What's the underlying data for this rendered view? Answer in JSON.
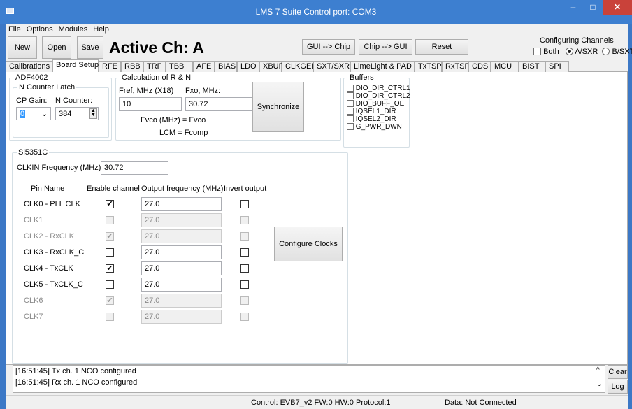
{
  "window": {
    "title": "LMS 7 Suite  Control port: COM3",
    "min": "–",
    "max": "□",
    "close": "✕"
  },
  "menu": [
    "File",
    "Options",
    "Modules",
    "Help"
  ],
  "toolbar": {
    "new": "New",
    "open": "Open",
    "save": "Save",
    "active_channel": "Active Ch: A",
    "gui_to_chip": "GUI --> Chip",
    "chip_to_gui": "Chip --> GUI",
    "reset": "Reset"
  },
  "configuring": {
    "title": "Configuring Channels",
    "both": "Both",
    "a": "A/SXR",
    "b": "B/SXT",
    "selected": "A/SXR"
  },
  "tabs": [
    "Calibrations",
    "Board Setup",
    "RFE",
    "RBB",
    "TRF",
    "TBB",
    "AFE",
    "BIAS",
    "LDO",
    "XBUF",
    "CLKGEN",
    "SXT/SXR",
    "LimeLight & PAD",
    "TxTSP",
    "RxTSP",
    "CDS",
    "MCU",
    "BIST",
    "SPI"
  ],
  "active_tab": "Board Setup",
  "adf": {
    "title": "ADF4002",
    "ncl_title": "N Counter Latch",
    "cp_gain_label": "CP Gain:",
    "cp_gain_value": "0",
    "n_counter_label": "N Counter:",
    "n_counter_value": "384"
  },
  "calc": {
    "title": "Calculation of R & N",
    "fref_label": "Fref, MHz (X18)",
    "fref_value": "10",
    "fxo_label": "Fxo, MHz:",
    "fxo_value": "30.72",
    "fvco": "Fvco (MHz) = Fvco",
    "lcm": "LCM = Fcomp",
    "sync": "Synchronize"
  },
  "buffers": {
    "title": "Buffers",
    "items": [
      "DIO_DIR_CTRL1",
      "DIO_DIR_CTRL2",
      "DIO_BUFF_OE",
      "IQSEL1_DIR",
      "IQSEL2_DIR",
      "G_PWR_DWN"
    ]
  },
  "si": {
    "title": "Si5351C",
    "clkin_label": "CLKIN Frequency (MHz):",
    "clkin_value": "30.72",
    "headers": {
      "pin": "Pin Name",
      "enable": "Enable channel",
      "freq": "Output frequency (MHz)",
      "invert": "Invert output"
    },
    "rows": [
      {
        "name": "CLK0 - PLL CLK",
        "enabled": true,
        "freq": "27.0",
        "active": true
      },
      {
        "name": "CLK1",
        "enabled": false,
        "freq": "27.0",
        "active": false
      },
      {
        "name": "CLK2 - RxCLK",
        "enabled": true,
        "freq": "27.0",
        "active": false
      },
      {
        "name": "CLK3 - RxCLK_C",
        "enabled": false,
        "freq": "27.0",
        "active": true
      },
      {
        "name": "CLK4 - TxCLK",
        "enabled": true,
        "freq": "27.0",
        "active": true
      },
      {
        "name": "CLK5 - TxCLK_C",
        "enabled": false,
        "freq": "27.0",
        "active": true
      },
      {
        "name": "CLK6",
        "enabled": true,
        "freq": "27.0",
        "active": false
      },
      {
        "name": "CLK7",
        "enabled": false,
        "freq": "27.0",
        "active": false
      }
    ],
    "configure": "Configure Clocks"
  },
  "log": [
    "[16:51:45] Tx ch. 1 NCO configured",
    "[16:51:45] Rx ch. 1 NCO configured"
  ],
  "log_buttons": {
    "clear": "Clear",
    "log": "Log"
  },
  "status": {
    "control": "Control: EVB7_v2  FW:0 HW:0 Protocol:1",
    "data": "Data: Not Connected"
  },
  "check_mark": "✔"
}
